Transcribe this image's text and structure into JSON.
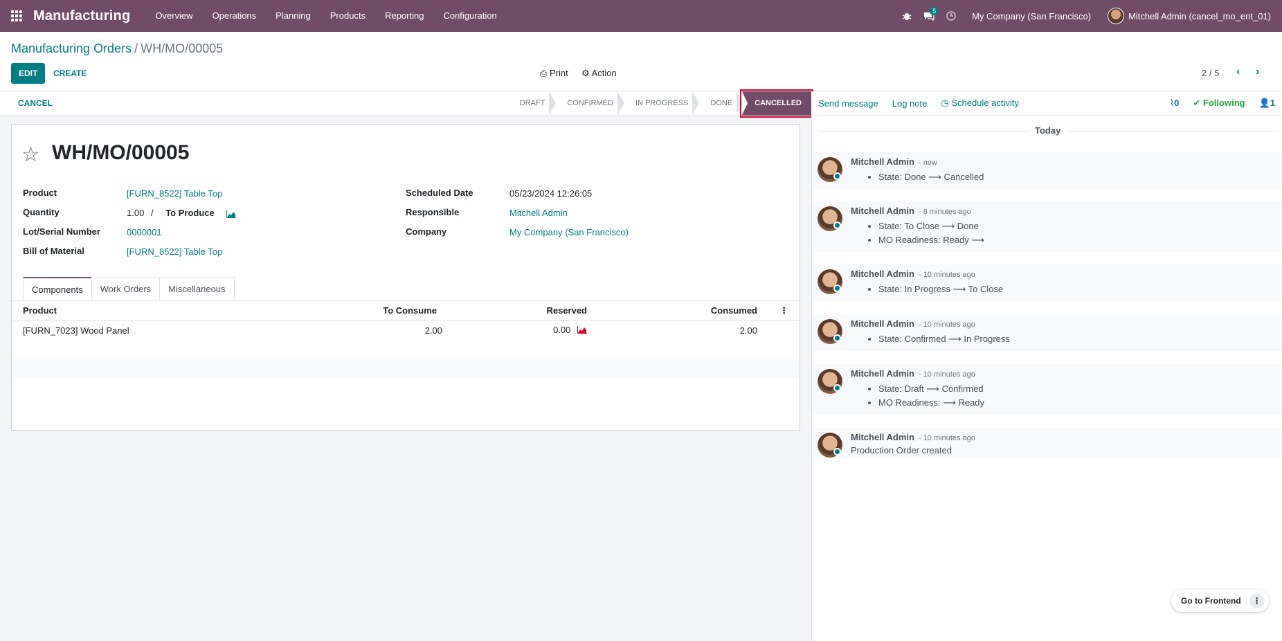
{
  "navbar": {
    "brand": "Manufacturing",
    "menu": [
      "Overview",
      "Operations",
      "Planning",
      "Products",
      "Reporting",
      "Configuration"
    ],
    "messages_badge": "5",
    "company": "My Company (San Francisco)",
    "user": "Mitchell Admin (cancel_mo_ent_01)"
  },
  "control": {
    "breadcrumb_parent": "Manufacturing Orders",
    "breadcrumb_sep": "/",
    "breadcrumb_current": "WH/MO/00005",
    "edit_label": "EDIT",
    "create_label": "CREATE",
    "print_label": "Print",
    "action_label": "Action",
    "pager": "2 / 5"
  },
  "statusbar": {
    "cancel_label": "CANCEL",
    "stages": [
      "DRAFT",
      "CONFIRMED",
      "IN PROGRESS",
      "DONE",
      "CANCELLED"
    ],
    "active_stage": "CANCELLED"
  },
  "chatter_top": {
    "send_message": "Send message",
    "log_note": "Log note",
    "schedule_activity": "Schedule activity",
    "attachments": "0",
    "following": "Following",
    "followers": "1"
  },
  "form": {
    "title": "WH/MO/00005",
    "product_label": "Product",
    "product_value": "[FURN_8522] Table Top",
    "quantity_label": "Quantity",
    "quantity_value": "1.00",
    "quantity_sep": "/",
    "to_produce": "To Produce",
    "lot_label": "Lot/Serial Number",
    "lot_value": "0000001",
    "bom_label": "Bill of Material",
    "bom_value": "[FURN_8522] Table Top",
    "scheduled_label": "Scheduled Date",
    "scheduled_value": "05/23/2024 12:26:05",
    "responsible_label": "Responsible",
    "responsible_value": "Mitchell Admin",
    "company_label": "Company",
    "company_value": "My Company (San Francisco)"
  },
  "tabs": [
    "Components",
    "Work Orders",
    "Miscellaneous"
  ],
  "components": {
    "headers": [
      "Product",
      "To Consume",
      "Reserved",
      "Consumed"
    ],
    "rows": [
      {
        "product": "[FURN_7023] Wood Panel",
        "to_consume": "2.00",
        "reserved": "0.00",
        "consumed": "2.00"
      }
    ]
  },
  "chatter": {
    "today_label": "Today",
    "messages": [
      {
        "author": "Mitchell Admin",
        "time": "- now",
        "lines": [
          "State: Done ⟶ Cancelled"
        ]
      },
      {
        "author": "Mitchell Admin",
        "time": "- 8 minutes ago",
        "lines": [
          "State: To Close ⟶ Done",
          "MO Readiness: Ready ⟶"
        ]
      },
      {
        "author": "Mitchell Admin",
        "time": "- 10 minutes ago",
        "lines": [
          "State: In Progress ⟶ To Close"
        ]
      },
      {
        "author": "Mitchell Admin",
        "time": "- 10 minutes ago",
        "lines": [
          "State: Confirmed ⟶ In Progress"
        ]
      },
      {
        "author": "Mitchell Admin",
        "time": "- 10 minutes ago",
        "lines": [
          "State: Draft ⟶ Confirmed",
          "MO Readiness: ⟶ Ready"
        ]
      },
      {
        "author": "Mitchell Admin",
        "time": "- 10 minutes ago",
        "plain": "Production Order created"
      }
    ]
  },
  "go_frontend": "Go to Frontend",
  "colors": {
    "brand": "#714b67",
    "accent": "#017e84"
  }
}
